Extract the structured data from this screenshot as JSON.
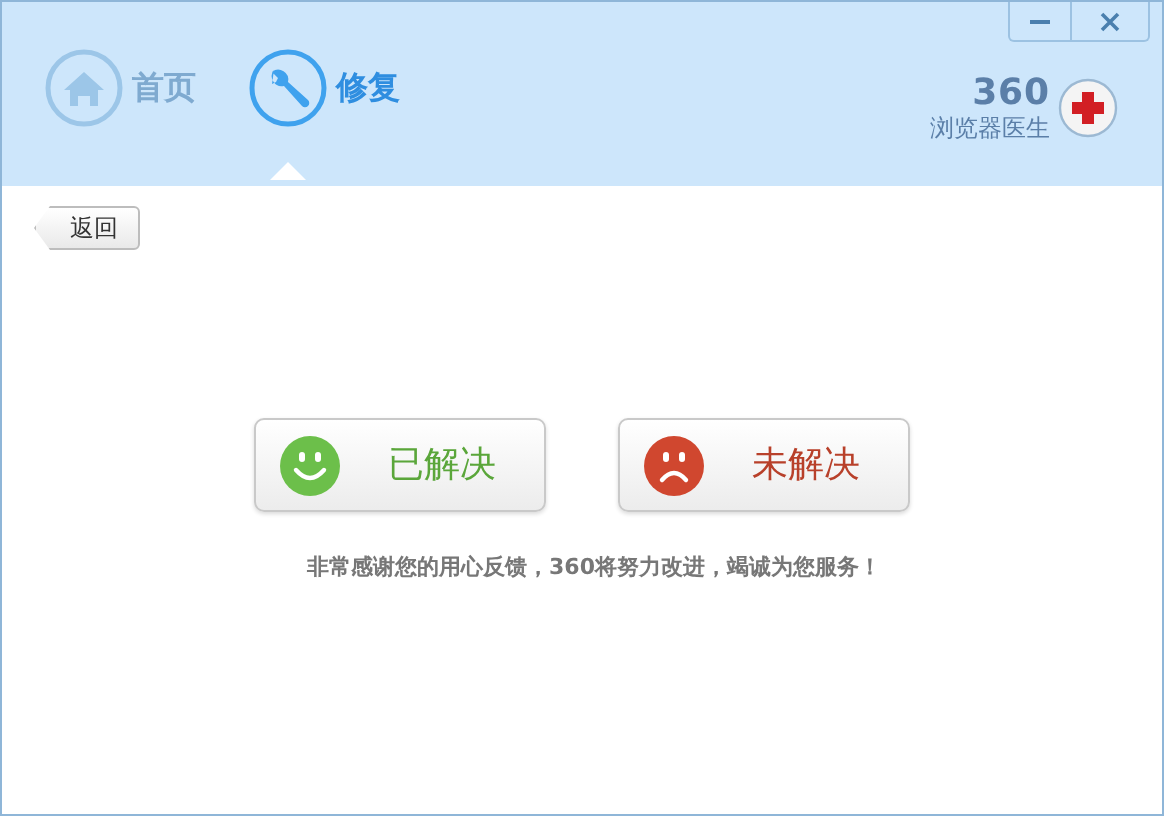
{
  "tabs": [
    {
      "label": "首页",
      "kind": "home",
      "selected": false
    },
    {
      "label": "修复",
      "kind": "repair",
      "selected": true
    }
  ],
  "brand": {
    "number": "360",
    "name": "浏览器医生"
  },
  "back_button": "返回",
  "choices": [
    {
      "label": "已解决",
      "kind": "solved"
    },
    {
      "label": "未解决",
      "kind": "unsolved"
    }
  ],
  "message": "非常感谢您的用心反馈，360将努力改进，竭诚为您服务！"
}
